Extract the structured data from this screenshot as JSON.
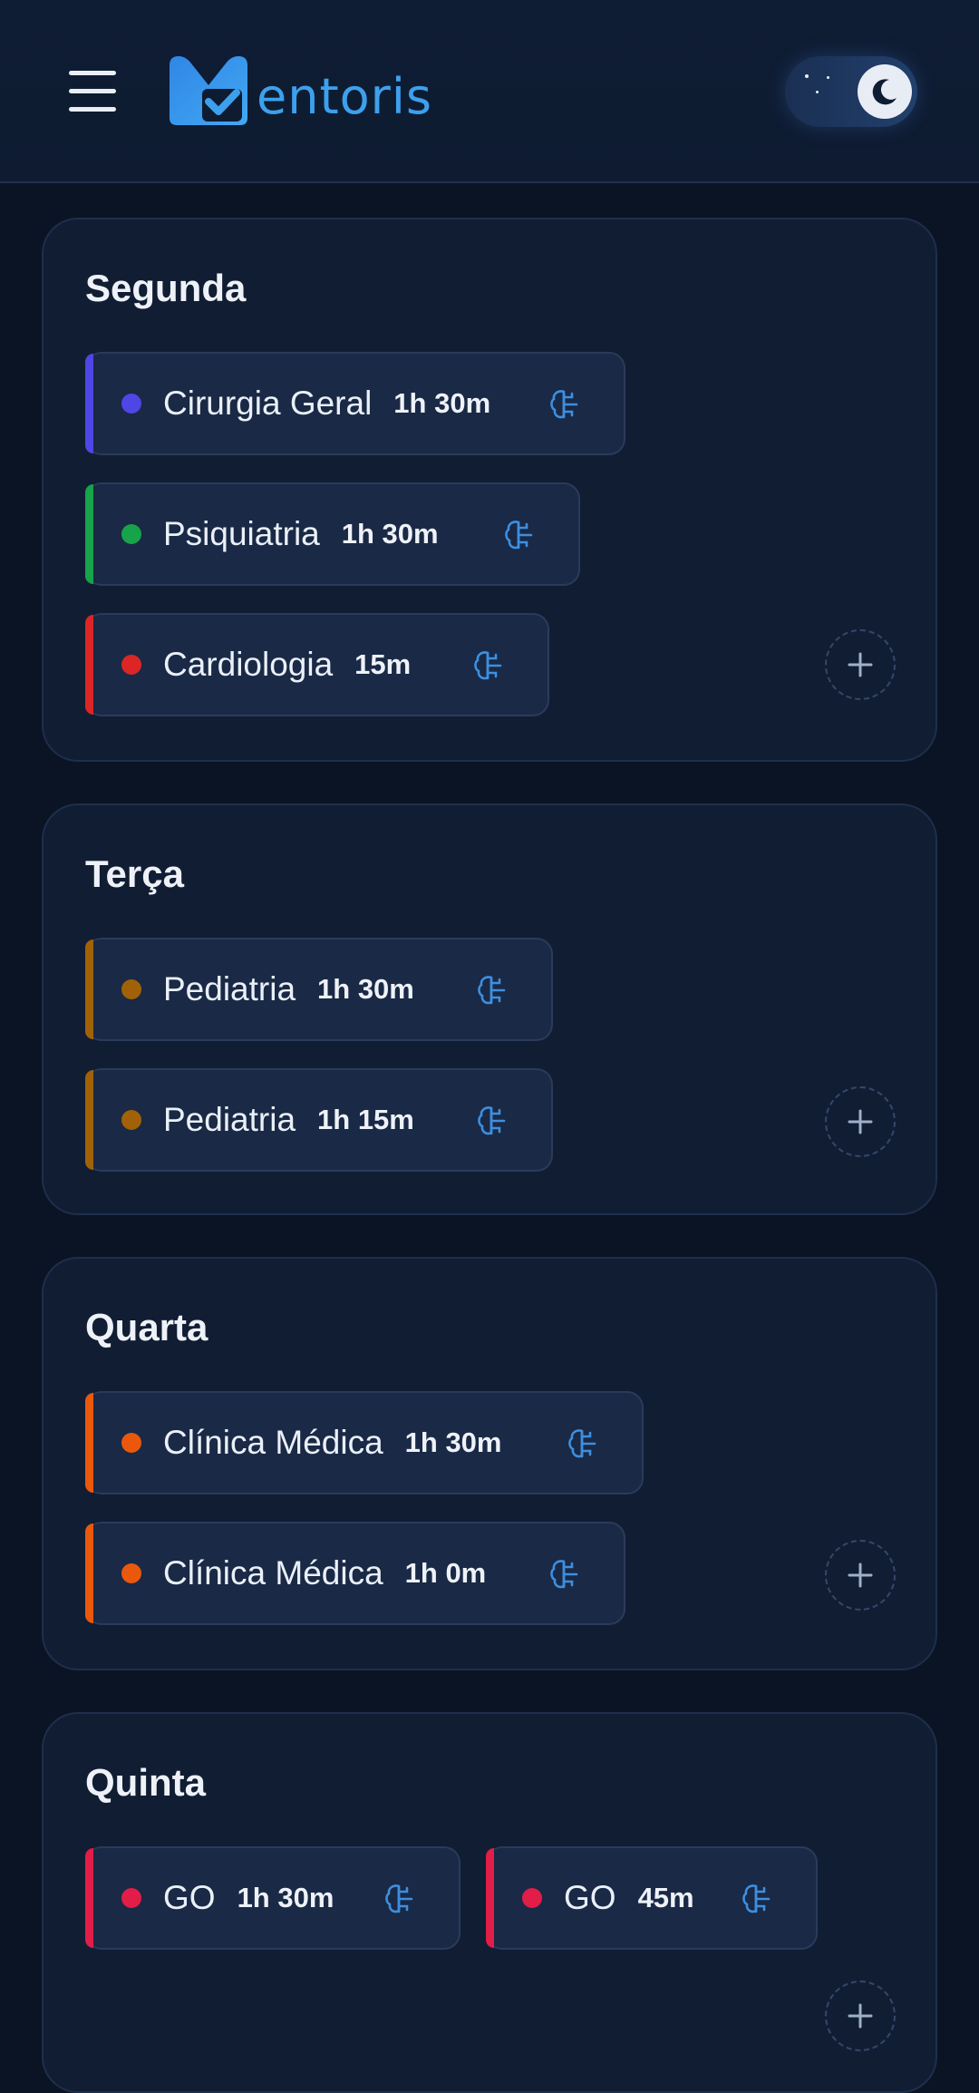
{
  "header": {
    "logo_text": "entoris",
    "menu_icon": "hamburger-icon",
    "theme_toggle_icon": "moon-icon"
  },
  "colors": {
    "background": "#0b1424",
    "card": "#111d33",
    "accent_blue": "#3da0ec",
    "cirurgia": "#4f46e5",
    "psiquiatria": "#16a34a",
    "cardiologia": "#dc2626",
    "pediatria": "#a16207",
    "clinica": "#ea580c",
    "go": "#e11d48"
  },
  "days": [
    {
      "title": "Segunda",
      "subjects": [
        {
          "name": "Cirurgia Geral",
          "duration": "1h 30m",
          "color": "#4f46e5"
        },
        {
          "name": "Psiquiatria",
          "duration": "1h 30m",
          "color": "#16a34a"
        },
        {
          "name": "Cardiologia",
          "duration": "15m",
          "color": "#dc2626"
        }
      ]
    },
    {
      "title": "Terça",
      "subjects": [
        {
          "name": "Pediatria",
          "duration": "1h 30m",
          "color": "#a16207"
        },
        {
          "name": "Pediatria",
          "duration": "1h 15m",
          "color": "#a16207"
        }
      ]
    },
    {
      "title": "Quarta",
      "subjects": [
        {
          "name": "Clínica Médica",
          "duration": "1h 30m",
          "color": "#ea580c"
        },
        {
          "name": "Clínica Médica",
          "duration": "1h 0m",
          "color": "#ea580c"
        }
      ]
    },
    {
      "title": "Quinta",
      "subjects": [
        {
          "name": "GO",
          "duration": "1h 30m",
          "color": "#e11d48"
        },
        {
          "name": "GO",
          "duration": "45m",
          "color": "#e11d48"
        }
      ]
    }
  ]
}
